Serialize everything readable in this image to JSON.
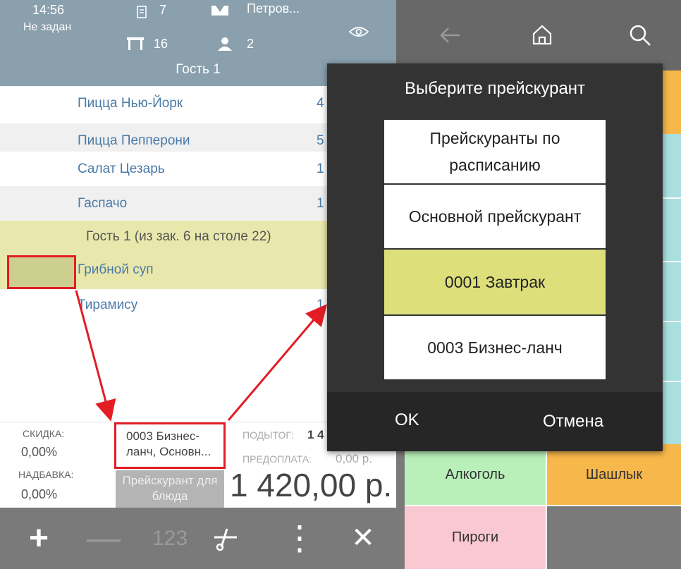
{
  "header": {
    "time": "14:56",
    "status": "Не задан",
    "orders_count": "7",
    "table_number": "16",
    "waiter": "Петров...",
    "guests_count": "2"
  },
  "guest_title": "Гость 1",
  "order_items": [
    {
      "name": "Пицца Нью-Йорк",
      "qty": "4"
    },
    {
      "name": "Пицца Пепперони",
      "qty": "5"
    },
    {
      "name": "Салат Цезарь",
      "qty": "1"
    },
    {
      "name": "Гаспачо",
      "qty": "1"
    }
  ],
  "merged_group": {
    "title": "Гость 1 (из зак. 6 на столе 22)",
    "items": [
      {
        "name": "Грибной суп",
        "qty": ""
      }
    ]
  },
  "extra_item": {
    "name": "Тирамису",
    "qty": "1"
  },
  "summary": {
    "discount_label": "СКИДКА:",
    "discount_value": "0,00%",
    "surcharge_label": "НАДБАВКА:",
    "surcharge_value": "0,00%",
    "price_list_value": "0003 Бизнес-ланч, Основн...",
    "price_list_button": "Прейскурант для блюда",
    "subtotal_label": "ПОДЫТОГ:",
    "subtotal_value": "1 4",
    "prepayment_label": "ПРЕДОПЛАТА:",
    "prepayment_value": "0,00 р.",
    "total": "1 420,00 р."
  },
  "bottom_bar": {
    "plus": "+",
    "minus": "—",
    "numpad": "123",
    "more": "⋮",
    "close": "✕"
  },
  "right_tiles": {
    "alcohol": "Алкоголь",
    "shashlik": "Шашлык",
    "pies": "Пироги"
  },
  "dialog": {
    "title": "Выберите прейскурант",
    "options": [
      "Прейскуранты по расписанию",
      "Основной прейскурант",
      "0001 Завтрак",
      "0003 Бизнес-ланч"
    ],
    "ok": "OK",
    "cancel": "Отмена"
  },
  "colors": {
    "header": "#8aa0ad",
    "selected_group": "#e9e8ac",
    "selected_option": "#dcdf7a",
    "highlight_border": "#e21d25",
    "dialog_bg": "#333333"
  }
}
